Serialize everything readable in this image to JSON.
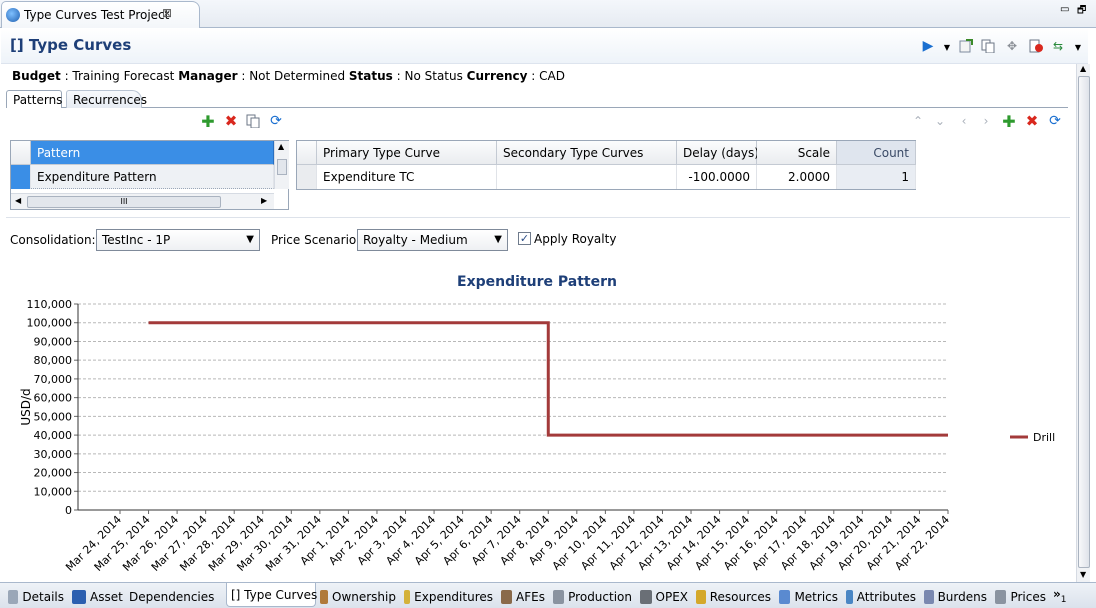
{
  "editor_tab": {
    "title": "Type Curves Test Project",
    "close": "⊠"
  },
  "window_controls": {
    "minimize": "▭",
    "restore": "🗗"
  },
  "header": {
    "title": "[] Type Curves"
  },
  "info": {
    "budget_label": "Budget",
    "budget_value": " : Training Forecast ",
    "manager_label": "Manager",
    "manager_value": " : Not Determined ",
    "status_label": "Status",
    "status_value": " : No Status ",
    "currency_label": "Currency",
    "currency_value": " : CAD"
  },
  "subtabs": [
    {
      "label": "Patterns"
    },
    {
      "label": "Recurrences"
    }
  ],
  "pattern_grid": {
    "header": "Pattern",
    "rows": [
      {
        "name": "Expenditure Pattern"
      }
    ],
    "hscroll_thumb": "III"
  },
  "curve_grid": {
    "columns": [
      "Primary Type Curve",
      "Secondary Type Curves",
      "Delay (days)",
      "Scale",
      "Count"
    ],
    "rows": [
      {
        "primary": "Expenditure TC",
        "secondary": "",
        "delay": "-100.0000",
        "scale": "2.0000",
        "count": "1"
      }
    ]
  },
  "controls": {
    "consolidation_label": "Consolidation:",
    "consolidation_value": "TestInc - 1P",
    "price_label": "Price Scenario:",
    "price_value": "Royalty - Medium",
    "apply_royalty_label": "Apply Royalty",
    "apply_royalty_checked": true
  },
  "chart_data": {
    "type": "line",
    "title": "Expenditure Pattern",
    "xlabel": "",
    "ylabel": "USD/d",
    "ylim": [
      0,
      110000
    ],
    "yticks": [
      "0",
      "10,000",
      "20,000",
      "30,000",
      "40,000",
      "50,000",
      "60,000",
      "70,000",
      "80,000",
      "90,000",
      "100,000",
      "110,000"
    ],
    "xticks": [
      "Mar 24, 2014",
      "Mar 25, 2014",
      "Mar 26, 2014",
      "Mar 27, 2014",
      "Mar 28, 2014",
      "Mar 29, 2014",
      "Mar 30, 2014",
      "Mar 31, 2014",
      "Apr 1, 2014",
      "Apr 2, 2014",
      "Apr 3, 2014",
      "Apr 4, 2014",
      "Apr 5, 2014",
      "Apr 6, 2014",
      "Apr 7, 2014",
      "Apr 8, 2014",
      "Apr 9, 2014",
      "Apr 10, 2014",
      "Apr 11, 2014",
      "Apr 12, 2014",
      "Apr 13, 2014",
      "Apr 14, 2014",
      "Apr 15, 2014",
      "Apr 16, 2014",
      "Apr 17, 2014",
      "Apr 18, 2014",
      "Apr 19, 2014",
      "Apr 20, 2014",
      "Apr 21, 2014",
      "Apr 22, 2014"
    ],
    "grid": true,
    "legend": "right",
    "series": [
      {
        "name": "Drill",
        "color": "#a33a3a",
        "x": [
          "2014-03-25",
          "2014-04-08",
          "2014-04-08",
          "2014-04-22"
        ],
        "y": [
          100000,
          100000,
          40000,
          40000
        ]
      }
    ]
  },
  "bottom_tabs": [
    {
      "label": "Details",
      "icon": "details-icon"
    },
    {
      "label": "Asset",
      "icon": "asset-icon"
    },
    {
      "label": "Dependencies",
      "icon": "dependencies-icon"
    },
    {
      "label": "[] Type Curves",
      "icon": "",
      "active": true
    },
    {
      "label": "Ownership",
      "icon": "ownership-icon"
    },
    {
      "label": "Expenditures",
      "icon": "expenditures-icon"
    },
    {
      "label": "AFEs",
      "icon": "afes-icon"
    },
    {
      "label": "Production",
      "icon": "production-icon"
    },
    {
      "label": "OPEX",
      "icon": "opex-icon"
    },
    {
      "label": "Resources",
      "icon": "resources-icon"
    },
    {
      "label": "Metrics",
      "icon": "metrics-icon"
    },
    {
      "label": "Attributes",
      "icon": "attributes-icon"
    },
    {
      "label": "Burdens",
      "icon": "burdens-icon"
    },
    {
      "label": "Prices",
      "icon": "prices-icon"
    }
  ],
  "overflow_tabs": {
    "chevron": "»",
    "count": "1"
  },
  "colors": {
    "accent": "#1e3f78",
    "series": "#a33a3a",
    "selection": "#3a8ee6"
  }
}
